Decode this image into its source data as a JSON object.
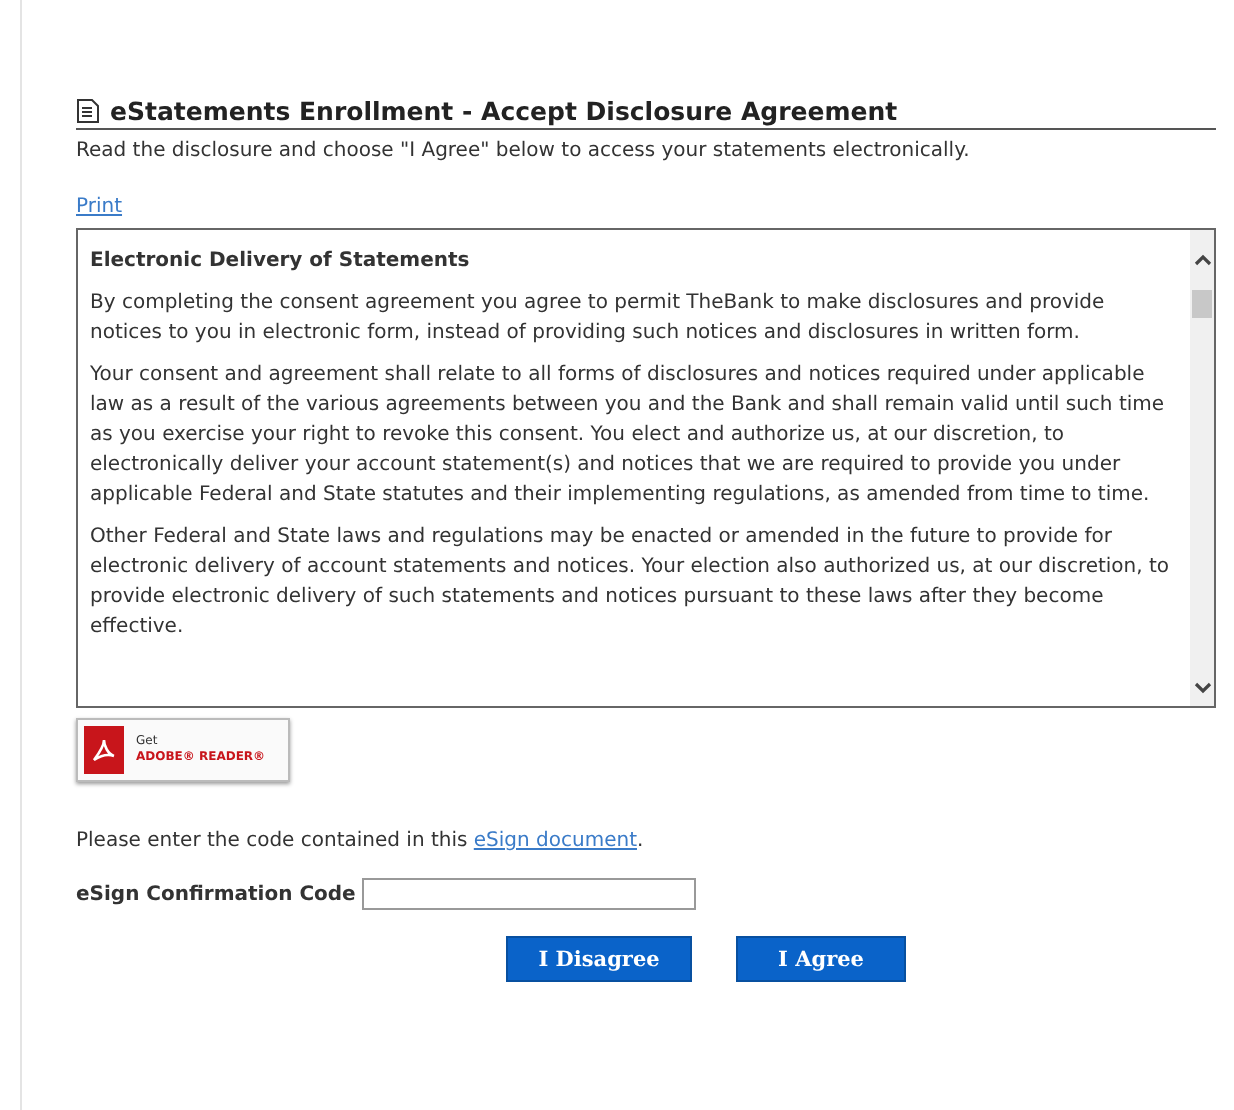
{
  "header": {
    "title": "eStatements Enrollment - Accept Disclosure Agreement",
    "instruction": "Read the disclosure and choose \"I Agree\" below to access your statements electronically."
  },
  "print_link": "Print",
  "disclosure": {
    "heading": "Electronic Delivery of Statements",
    "paragraphs": [
      "By completing the consent agreement you agree to permit TheBank to make disclosures and provide notices to you in electronic form, instead of providing such notices and disclosures in written form.",
      "Your consent and agreement shall relate to all forms of disclosures and notices required under applicable law as a result of the various agreements between you and the Bank and shall remain valid until such time as you exercise your right to revoke this consent. You elect and authorize us, at our discretion, to electronically deliver your account statement(s) and notices that we are required to provide you under applicable Federal and State statutes and their implementing regulations, as amended from time to time.",
      "Other Federal and State laws and regulations may be enacted or amended in the future to provide for electronic delivery of account statements and notices. Your election also authorized us, at our discretion, to provide electronic delivery of such statements and notices pursuant to these laws after they become effective."
    ]
  },
  "reader_badge": {
    "line1": "Get",
    "line2": "ADOBE® READER®"
  },
  "esign": {
    "prompt": "Please enter the code contained in this ",
    "link": "eSign document",
    "after": ".",
    "label": "eSign Confirmation Code"
  },
  "buttons": [
    "I Disagree",
    "I Agree"
  ]
}
